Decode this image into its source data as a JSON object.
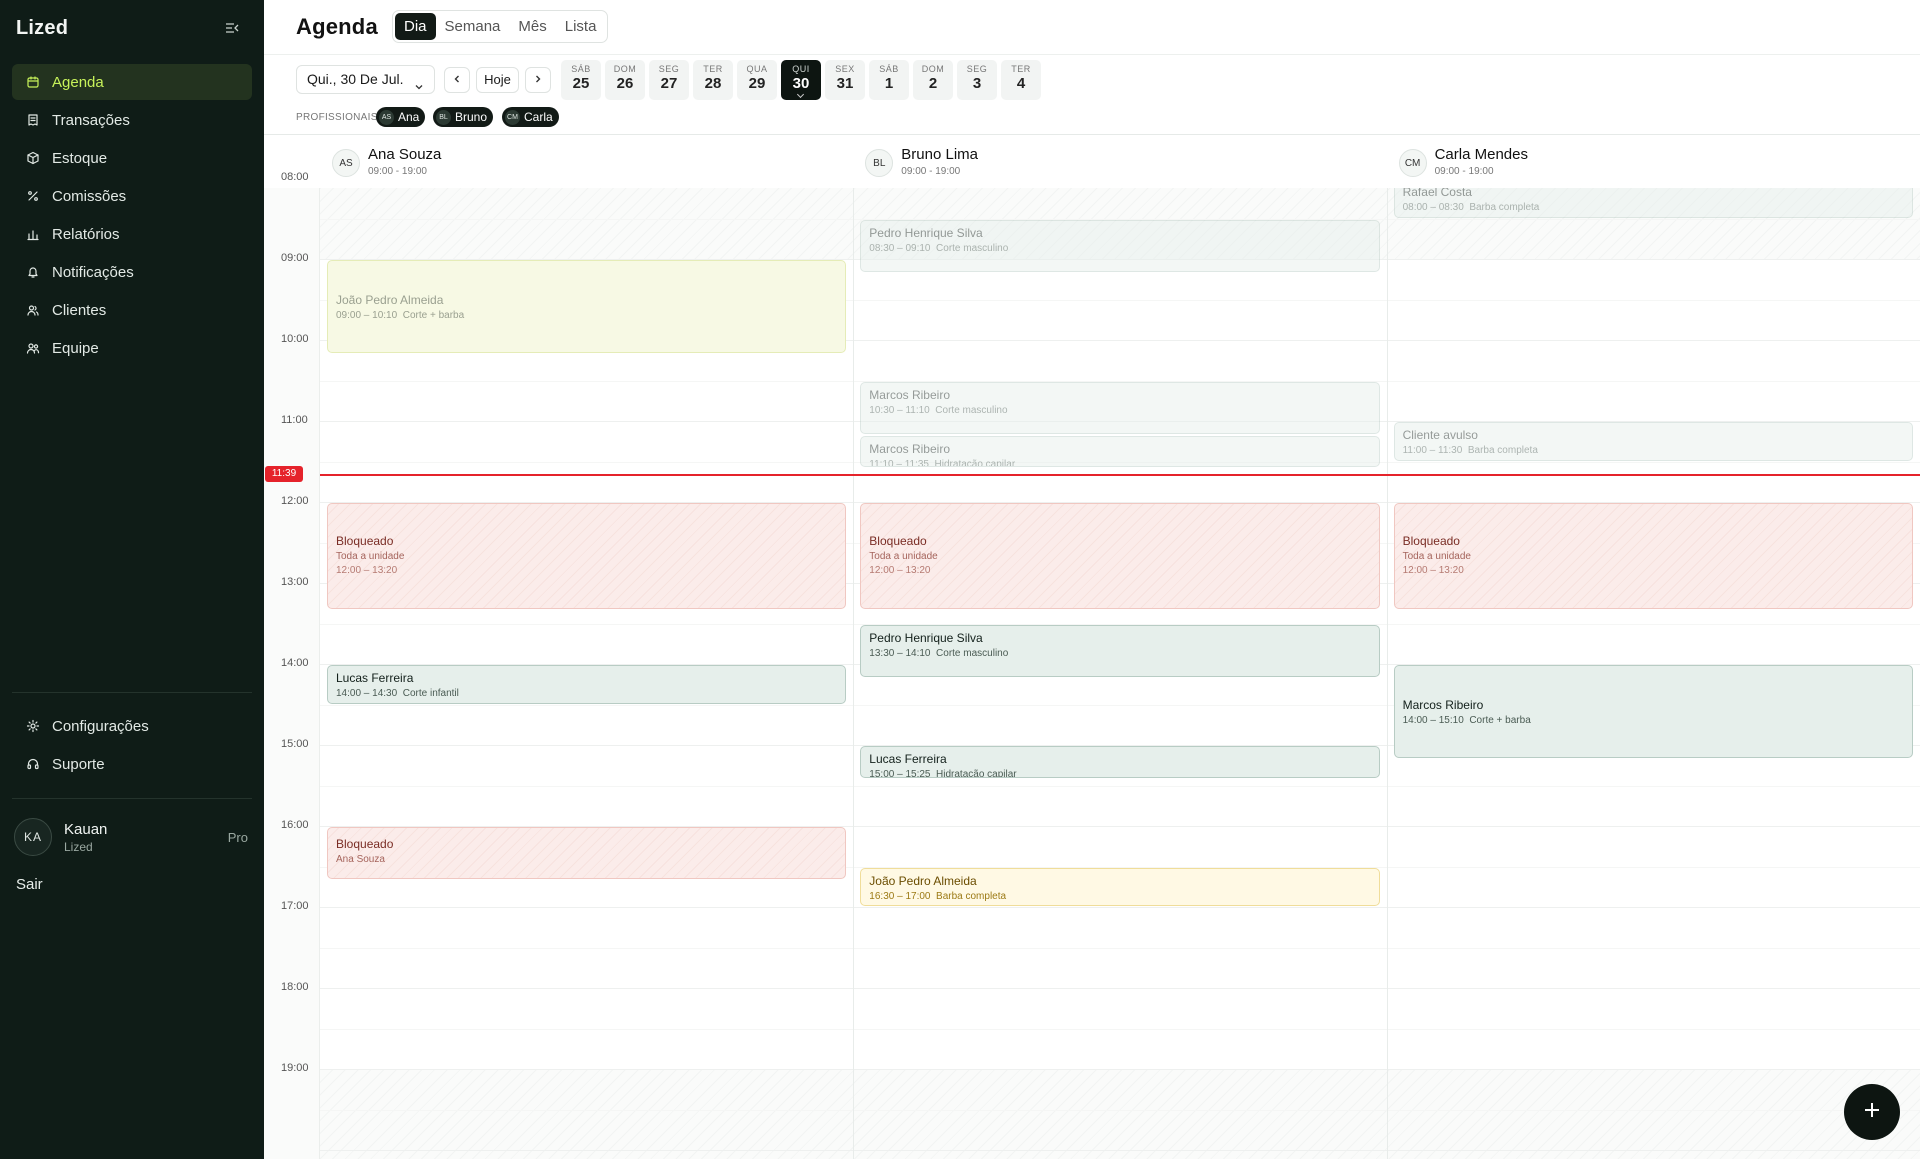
{
  "app": {
    "brand": "Lized"
  },
  "sidebar": {
    "items": [
      {
        "label": "Agenda",
        "icon": "calendar-icon",
        "active": true
      },
      {
        "label": "Transações",
        "icon": "receipt-icon"
      },
      {
        "label": "Estoque",
        "icon": "box-icon"
      },
      {
        "label": "Comissões",
        "icon": "percent-icon"
      },
      {
        "label": "Relatórios",
        "icon": "bar-chart-icon"
      },
      {
        "label": "Notificações",
        "icon": "bell-icon"
      },
      {
        "label": "Clientes",
        "icon": "users-icon"
      },
      {
        "label": "Equipe",
        "icon": "team-icon"
      }
    ],
    "bottom": [
      {
        "label": "Configurações",
        "icon": "gear-icon"
      },
      {
        "label": "Suporte",
        "icon": "headset-icon"
      }
    ],
    "user": {
      "initials": "KA",
      "name": "Kauan",
      "org": "Lized",
      "plan": "Pro"
    },
    "logout": "Sair"
  },
  "header": {
    "title": "Agenda",
    "views": [
      "Dia",
      "Semana",
      "Mês",
      "Lista"
    ],
    "active_view": "Dia",
    "date_label": "Qui., 30 De Jul.",
    "today_label": "Hoje",
    "days": [
      {
        "dow": "SÁB",
        "num": "25"
      },
      {
        "dow": "DOM",
        "num": "26"
      },
      {
        "dow": "SEG",
        "num": "27"
      },
      {
        "dow": "TER",
        "num": "28"
      },
      {
        "dow": "QUA",
        "num": "29"
      },
      {
        "dow": "QUI",
        "num": "30",
        "selected": true
      },
      {
        "dow": "SEX",
        "num": "31"
      },
      {
        "dow": "SÁB",
        "num": "1"
      },
      {
        "dow": "DOM",
        "num": "2"
      },
      {
        "dow": "SEG",
        "num": "3"
      },
      {
        "dow": "TER",
        "num": "4"
      }
    ],
    "professionals_label": "PROFISSIONAIS",
    "professionals": [
      {
        "initials": "AS",
        "name": "Ana"
      },
      {
        "initials": "BL",
        "name": "Bruno"
      },
      {
        "initials": "CM",
        "name": "Carla"
      }
    ]
  },
  "columns": [
    {
      "initials": "AS",
      "name": "Ana Souza",
      "hours": "09:00 - 19:00"
    },
    {
      "initials": "BL",
      "name": "Bruno Lima",
      "hours": "09:00 - 19:00"
    },
    {
      "initials": "CM",
      "name": "Carla Mendes",
      "hours": "09:00 - 19:00"
    }
  ],
  "time_labels": [
    "08:00",
    "09:00",
    "10:00",
    "11:00",
    "12:00",
    "13:00",
    "14:00",
    "15:00",
    "16:00",
    "17:00",
    "18:00",
    "19:00"
  ],
  "now_label": "11:39",
  "events": [
    {
      "col": 0,
      "start": "09:00",
      "end": "10:10",
      "style": "yellow",
      "name": "João Pedro Almeida",
      "time": "09:00 – 10:10",
      "service": "Corte + barba"
    },
    {
      "col": 0,
      "start": "12:00",
      "end": "13:20",
      "style": "blocked",
      "name": "Bloqueado",
      "detail": "Toda a unidade",
      "time": "12:00 – 13:20"
    },
    {
      "col": 0,
      "start": "14:00",
      "end": "14:30",
      "style": "green",
      "name": "Lucas Ferreira",
      "time": "14:00 – 14:30",
      "service": "Corte infantil"
    },
    {
      "col": 0,
      "start": "16:00",
      "end": "16:40",
      "style": "blocked",
      "name": "Bloqueado",
      "detail": "Ana Souza"
    },
    {
      "col": 1,
      "start": "08:30",
      "end": "09:10",
      "style": "green",
      "faded": true,
      "name": "Pedro Henrique Silva",
      "time": "08:30 – 09:10",
      "service": "Corte masculino"
    },
    {
      "col": 1,
      "start": "10:30",
      "end": "11:10",
      "style": "green",
      "faded": true,
      "name": "Marcos Ribeiro",
      "time": "10:30 – 11:10",
      "service": "Corte masculino"
    },
    {
      "col": 1,
      "start": "11:10",
      "end": "11:35",
      "style": "green",
      "faded": true,
      "name": "Marcos Ribeiro",
      "time": "11:10 – 11:35",
      "service": "Hidratação capilar"
    },
    {
      "col": 1,
      "start": "12:00",
      "end": "13:20",
      "style": "blocked",
      "name": "Bloqueado",
      "detail": "Toda a unidade",
      "time": "12:00 – 13:20"
    },
    {
      "col": 1,
      "start": "13:30",
      "end": "14:10",
      "style": "green",
      "name": "Pedro Henrique Silva",
      "time": "13:30 – 14:10",
      "service": "Corte masculino"
    },
    {
      "col": 1,
      "start": "15:00",
      "end": "15:25",
      "style": "green",
      "name": "Lucas Ferreira",
      "time": "15:00 – 15:25",
      "service": "Hidratação capilar"
    },
    {
      "col": 1,
      "start": "16:30",
      "end": "17:00",
      "style": "amber",
      "name": "João Pedro Almeida",
      "time": "16:30 – 17:00",
      "service": "Barba completa"
    },
    {
      "col": 2,
      "start": "08:00",
      "end": "08:30",
      "style": "green",
      "faded": true,
      "name": "Rafael Costa",
      "time": "08:00 – 08:30",
      "service": "Barba completa"
    },
    {
      "col": 2,
      "start": "11:00",
      "end": "11:30",
      "style": "green",
      "faded": true,
      "name": "Cliente avulso",
      "time": "11:00 – 11:30",
      "service": "Barba completa"
    },
    {
      "col": 2,
      "start": "12:00",
      "end": "13:20",
      "style": "blocked",
      "name": "Bloqueado",
      "detail": "Toda a unidade",
      "time": "12:00 – 13:20"
    },
    {
      "col": 2,
      "start": "14:00",
      "end": "15:10",
      "style": "green",
      "name": "Marcos Ribeiro",
      "time": "14:00 – 15:10",
      "service": "Corte + barba"
    }
  ],
  "fab": {
    "icon": "plus-icon"
  }
}
